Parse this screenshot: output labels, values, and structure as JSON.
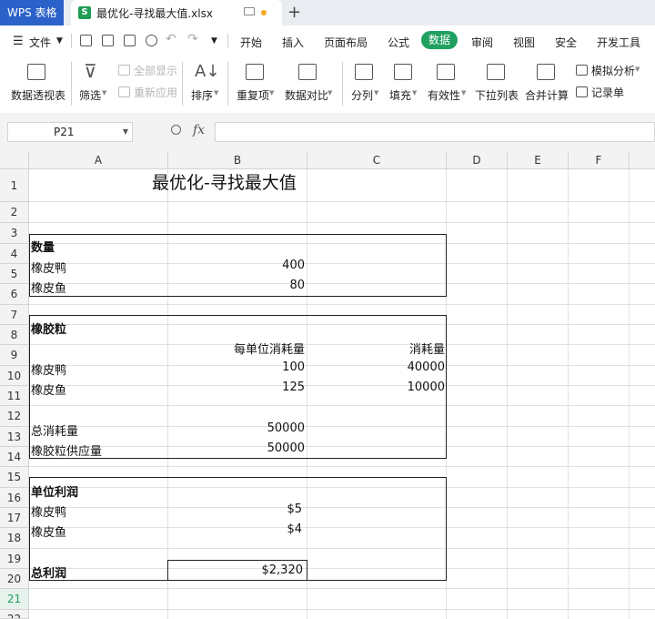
{
  "titlebar": {
    "app_name": "WPS 表格",
    "doc_icon": "S",
    "doc_name": "最优化-寻找最大值.xlsx",
    "new_tab": "+"
  },
  "menu": {
    "file": "文件",
    "tabs": [
      "开始",
      "插入",
      "页面布局",
      "公式",
      "数据",
      "审阅",
      "视图",
      "安全",
      "开发工具"
    ],
    "active_tab": "数据"
  },
  "ribbon": {
    "pivot": "数据透视表",
    "filter": "筛选",
    "show_all": "全部显示",
    "reapply": "重新应用",
    "sort": "排序",
    "duplicates": "重复项",
    "compare": "数据对比",
    "split": "分列",
    "fill": "填充",
    "validity": "有效性",
    "dropdown": "下拉列表",
    "consolidate": "合并计算",
    "simulate": "模拟分析",
    "record": "记录单"
  },
  "formula_bar": {
    "name_box": "P21",
    "fx": "fx",
    "formula": ""
  },
  "grid": {
    "columns": [
      "A",
      "B",
      "C",
      "D",
      "E",
      "F"
    ],
    "rows": [
      "1",
      "2",
      "3",
      "4",
      "5",
      "6",
      "7",
      "8",
      "9",
      "10",
      "11",
      "12",
      "13",
      "14",
      "15",
      "16",
      "17",
      "18",
      "19",
      "20",
      "21",
      "22"
    ],
    "selected_row": "21"
  },
  "sheet": {
    "title": "最优化-寻找最大值",
    "qty_header": "数量",
    "duck": "橡皮鸭",
    "fish": "橡皮鱼",
    "duck_qty": "400",
    "fish_qty": "80",
    "granule_header": "橡胶粒",
    "per_unit_header": "每单位消耗量",
    "consumption_header": "消耗量",
    "duck_per_unit": "100",
    "duck_consumption": "40000",
    "fish_per_unit": "125",
    "fish_consumption": "10000",
    "total_consumption_label": "总消耗量",
    "total_consumption": "50000",
    "supply_label": "橡胶粒供应量",
    "supply": "50000",
    "profit_header": "单位利润",
    "duck_profit": "$5",
    "fish_profit": "$4",
    "total_profit_label": "总利润",
    "total_profit": "$2,320"
  }
}
